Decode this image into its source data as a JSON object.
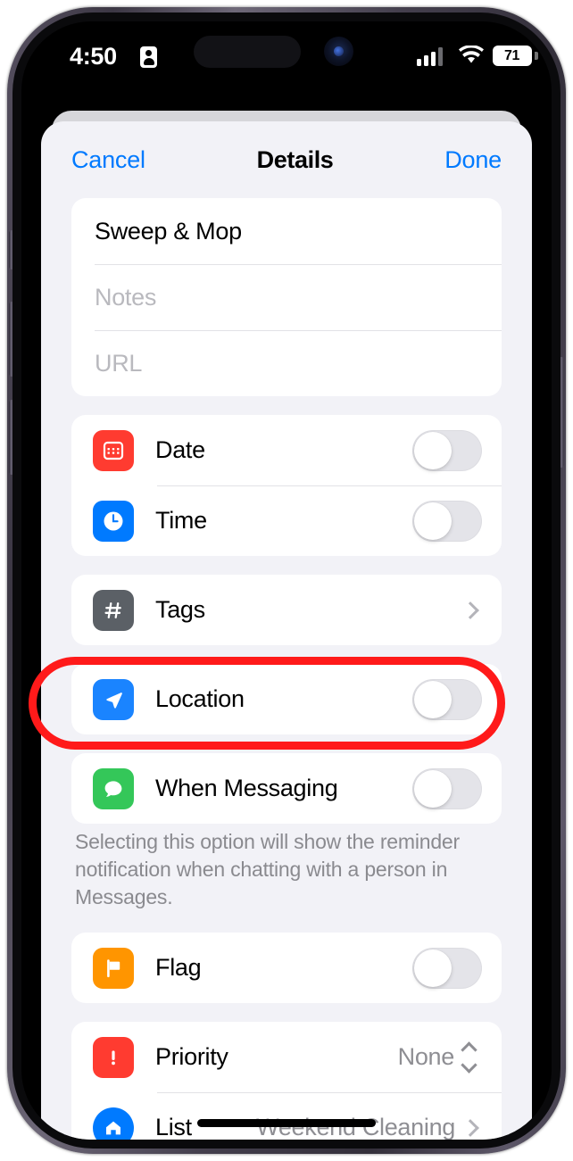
{
  "status_bar": {
    "time": "4:50",
    "badge_icon": "person-badge-icon",
    "signal_icon": "cellular-signal-icon",
    "wifi_icon": "wifi-icon",
    "battery_level": "71"
  },
  "navbar": {
    "cancel_label": "Cancel",
    "title": "Details",
    "done_label": "Done"
  },
  "fields": {
    "title_value": "Sweep & Mop",
    "notes_placeholder": "Notes",
    "url_placeholder": "URL"
  },
  "rows": {
    "date": {
      "label": "Date",
      "icon": "calendar-icon",
      "color": "#ff3b30",
      "toggle": "off"
    },
    "time": {
      "label": "Time",
      "icon": "clock-icon",
      "color": "#007aff",
      "toggle": "off"
    },
    "tags": {
      "label": "Tags",
      "icon": "hashtag-icon",
      "color": "#5b6066"
    },
    "location": {
      "label": "Location",
      "icon": "navigation-arrow-icon",
      "color": "#1a84ff",
      "toggle": "off"
    },
    "when_messaging": {
      "label": "When Messaging",
      "icon": "message-bubble-icon",
      "color": "#34c759",
      "toggle": "off"
    },
    "flag": {
      "label": "Flag",
      "icon": "flag-icon",
      "color": "#ff9500",
      "toggle": "off"
    },
    "priority": {
      "label": "Priority",
      "icon": "exclamation-icon",
      "color": "#ff3b30",
      "value": "None"
    },
    "list": {
      "label": "List",
      "icon": "home-icon",
      "color": "#007aff",
      "value": "Weekend Cleaning"
    }
  },
  "footnote": "Selecting this option will show the reminder notification when chatting with a person in Messages.",
  "annotation": {
    "name": "red-highlight-oval",
    "color": "#ff1a1a",
    "target": "when-messaging-row"
  }
}
